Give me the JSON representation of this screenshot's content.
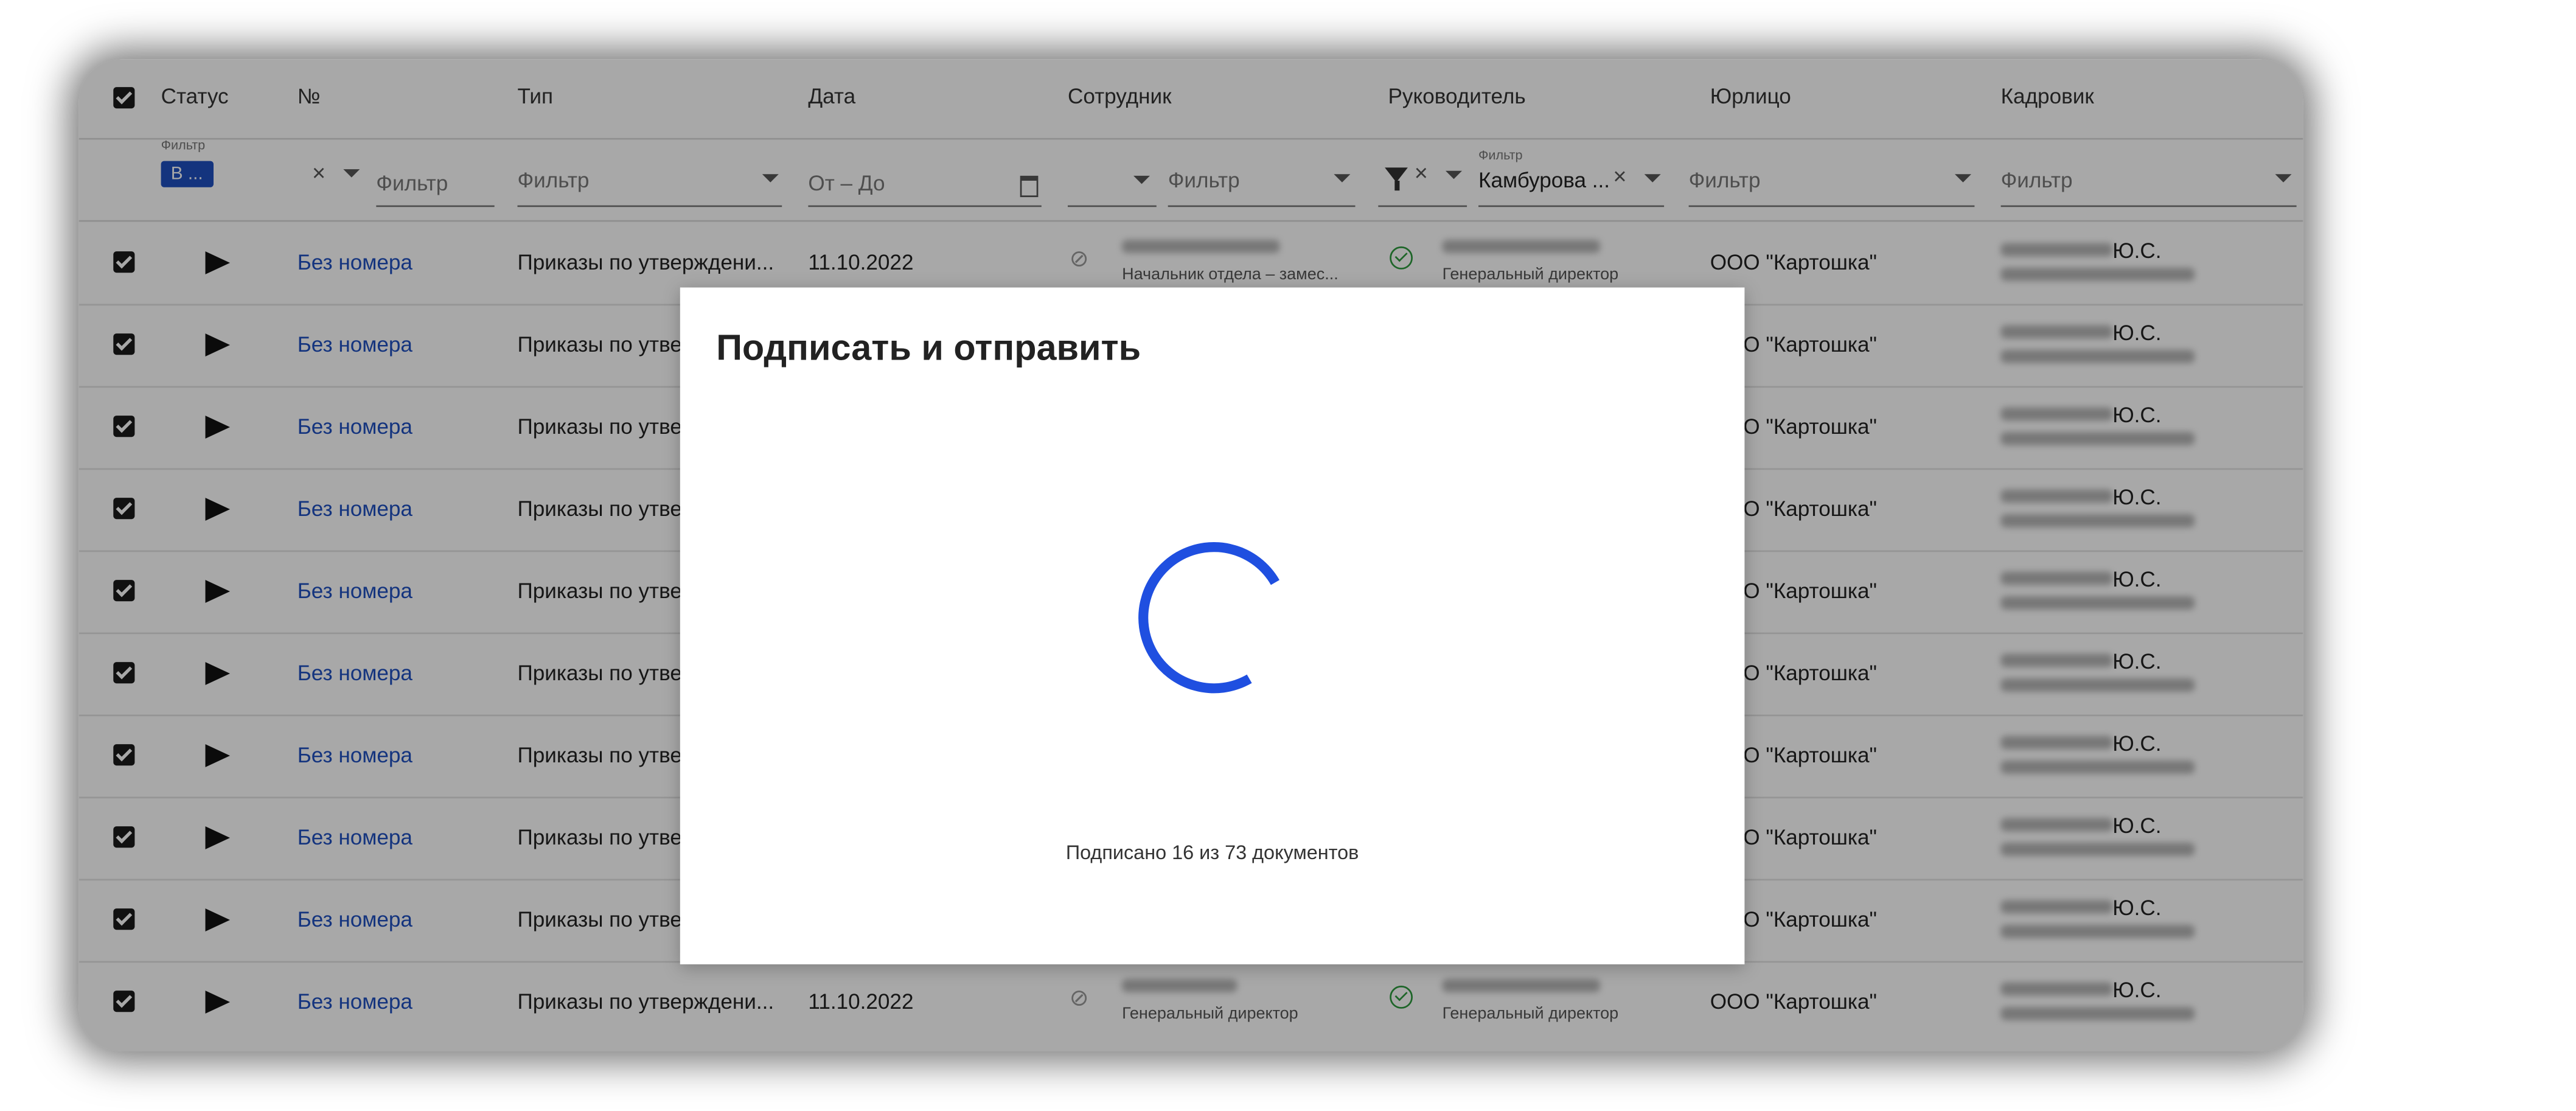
{
  "columns": [
    "Статус",
    "№",
    "Тип",
    "Дата",
    "Сотрудник",
    "Руководитель",
    "Юрлицо",
    "Кадровик"
  ],
  "filters": {
    "small_label": "Фильтр",
    "status_chip": "В ...",
    "placeholder": "Фильтр",
    "date_placeholder": "От – До",
    "manager_value": "Камбурова ...",
    "clear": "×"
  },
  "rows": [
    {
      "number": "Без номера",
      "type": "Приказы по утверждени...",
      "date": "11.10.2022",
      "employee_role": "Начальник отдела – замес...",
      "manager_role": "Генеральный директор",
      "entity": "ООО \"Картошка\"",
      "hr_initials": "Ю.С."
    },
    {
      "number": "Без номера",
      "type": "Приказы по утве",
      "entity": "ООО \"Картошка\"",
      "hr_initials": "Ю.С."
    },
    {
      "number": "Без номера",
      "type": "Приказы по утве",
      "entity": "ООО \"Картошка\"",
      "hr_initials": "Ю.С."
    },
    {
      "number": "Без номера",
      "type": "Приказы по утве",
      "entity": "ООО \"Картошка\"",
      "hr_initials": "Ю.С."
    },
    {
      "number": "Без номера",
      "type": "Приказы по утве",
      "entity": "ООО \"Картошка\"",
      "hr_initials": "Ю.С."
    },
    {
      "number": "Без номера",
      "type": "Приказы по утве",
      "entity": "ООО \"Картошка\"",
      "hr_initials": "Ю.С."
    },
    {
      "number": "Без номера",
      "type": "Приказы по утве",
      "entity": "ООО \"Картошка\"",
      "hr_initials": "Ю.С."
    },
    {
      "number": "Без номера",
      "type": "Приказы по утве",
      "entity": "ООО \"Картошка\"",
      "hr_initials": "Ю.С."
    },
    {
      "number": "Без номера",
      "type": "Приказы по утве",
      "entity": "ООО \"Картошка\"",
      "hr_initials": "Ю.С."
    },
    {
      "number": "Без номера",
      "type": "Приказы по утверждени...",
      "date": "11.10.2022",
      "employee_role": "Генеральный директор",
      "manager_role": "Генеральный директор",
      "entity": "ООО \"Картошка\"",
      "hr_initials": "Ю.С."
    }
  ],
  "dialog": {
    "title": "Подписать и отправить",
    "status": "Подписано 16 из 73 документов",
    "signed": 16,
    "total": 73
  },
  "icons": {
    "select_all": "checkbox-checked-icon",
    "status": "send-icon",
    "employee_status": "eye-off-icon",
    "manager_status": "check-circle-icon",
    "filter": "funnel-icon",
    "date": "calendar-icon",
    "loading": "spinner-icon"
  },
  "colors": {
    "link": "#1f4fbf",
    "spinner": "#1f4fe0",
    "chip": "#1f4fbf",
    "ok": "#2c9a3d"
  }
}
